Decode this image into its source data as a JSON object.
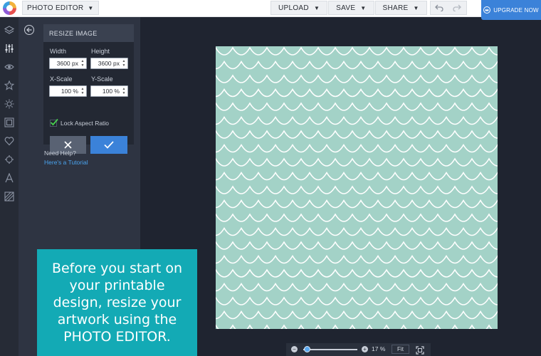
{
  "topbar": {
    "app_menu_label": "PHOTO EDITOR",
    "buttons": [
      {
        "label": "UPLOAD"
      },
      {
        "label": "SAVE"
      },
      {
        "label": "SHARE"
      }
    ],
    "upgrade_label": "UPGRADE NOW"
  },
  "rail": {
    "icons": [
      "layers-icon",
      "sliders-icon",
      "eye-icon",
      "star-icon",
      "sun-icon",
      "frame-icon",
      "heart-icon",
      "gear-icon",
      "text-icon",
      "texture-icon"
    ]
  },
  "panel": {
    "title": "RESIZE IMAGE",
    "width_label": "Width",
    "height_label": "Height",
    "width_value": "3600 px",
    "height_value": "3600 px",
    "xscale_label": "X-Scale",
    "yscale_label": "Y-Scale",
    "xscale_value": "100 %",
    "yscale_value": "100 %",
    "lock_label": "Lock Aspect Ratio",
    "lock_checked": true,
    "help_question": "Need Help?",
    "help_link": "Here's a Tutorial"
  },
  "zoom": {
    "level": 0.06,
    "label": "17 %",
    "fit_label": "Fit"
  },
  "caption": {
    "text": "Before you start on your printable design, resize your artwork using the PHOTO EDITOR."
  },
  "colors": {
    "accent": "#3b82d9",
    "caption_bg": "#13aab5",
    "artboard_bg": "#a3d2c7",
    "scallop_line": "#ffffff"
  }
}
